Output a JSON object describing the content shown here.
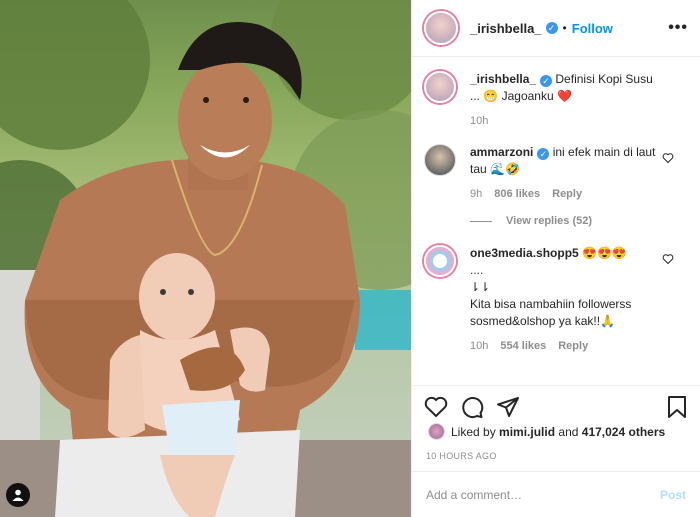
{
  "post": {
    "username": "_irishbella_",
    "follow_label": "Follow",
    "dot": "•",
    "more_label": "•••"
  },
  "caption": {
    "username": "_irishbella_",
    "text": "Definisi Kopi Susu ... 😁 Jagoanku ❤️",
    "time": "10h"
  },
  "comments": [
    {
      "username": "ammarzoni",
      "verified": true,
      "text": "ini efek main di laut tau 🌊🤣",
      "time": "9h",
      "likes": "806 likes",
      "reply_label": "Reply"
    },
    {
      "username": "one3media.shopp5",
      "verified": false,
      "text_line1": "😍😍😍",
      "text_line2": "....",
      "text_line3": "⇂⇂",
      "text_line4": "Kita bisa nambahiin followerss sosmed&olshop ya kak!!🙏",
      "time": "10h",
      "likes": "554 likes",
      "reply_label": "Reply"
    }
  ],
  "view_replies": "View replies (52)",
  "likes_summary": {
    "prefix": "Liked by",
    "user": "mimi.julid",
    "connector": "and",
    "count": "417,024 others"
  },
  "time_ago": "10 HOURS AGO",
  "add_comment": {
    "placeholder": "Add a comment…",
    "post_label": "Post"
  },
  "icons": {
    "heart": "heart-icon",
    "comment": "comment-icon",
    "share": "share-icon",
    "save": "bookmark-icon",
    "more": "more-icon",
    "verified": "verified-badge-icon",
    "tag": "user-tag-icon"
  },
  "colors": {
    "link": "#0095f6",
    "verified": "#3897f0",
    "muted": "#8e8e8e",
    "post_disabled": "#b2dffc",
    "heart_red": "#ed4956"
  }
}
